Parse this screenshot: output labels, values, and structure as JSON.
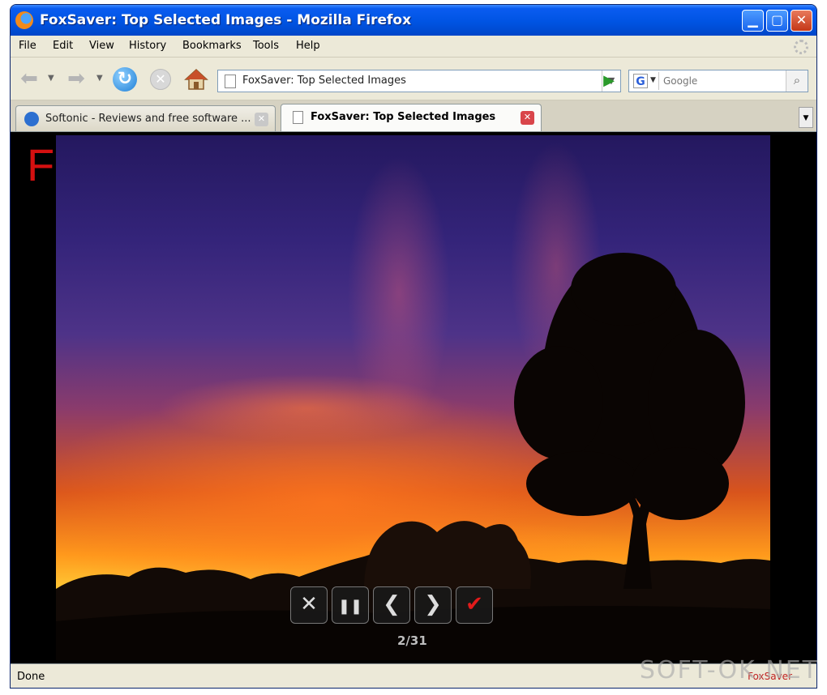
{
  "window": {
    "title": "FoxSaver: Top Selected Images - Mozilla Firefox",
    "app_icon": "firefox-icon",
    "controls": {
      "minimize": "minimize-icon",
      "maximize": "maximize-icon",
      "close": "close-icon"
    }
  },
  "menubar": {
    "items": [
      {
        "label": "File"
      },
      {
        "label": "Edit"
      },
      {
        "label": "View"
      },
      {
        "label": "History"
      },
      {
        "label": "Bookmarks"
      },
      {
        "label": "Tools"
      },
      {
        "label": "Help"
      }
    ]
  },
  "navbar": {
    "icons": [
      "back-arrow-icon",
      "forward-arrow-icon",
      "reload-icon",
      "stop-icon",
      "home-icon",
      "go-arrow-icon"
    ],
    "url": "FoxSaver: Top Selected Images",
    "search": {
      "engine_icon": "google-icon",
      "placeholder": "Google"
    }
  },
  "tabs": [
    {
      "label": "Softonic - Reviews and free software ...",
      "active": false,
      "icon": "softonic-icon"
    },
    {
      "label": "FoxSaver: Top Selected Images",
      "active": true,
      "icon": "page-icon"
    }
  ],
  "viewer": {
    "background_logo": "Fo",
    "controls": [
      {
        "name": "close",
        "icon": "x-icon",
        "glyph": "✕"
      },
      {
        "name": "pause",
        "icon": "pause-icon",
        "glyph": "❚❚"
      },
      {
        "name": "previous",
        "icon": "chevron-left-icon",
        "glyph": "❮"
      },
      {
        "name": "next",
        "icon": "chevron-right-icon",
        "glyph": "❯"
      },
      {
        "name": "select",
        "icon": "check-icon",
        "glyph": "✔"
      }
    ],
    "counter": "2/31"
  },
  "statusbar": {
    "text": "Done",
    "brand": "FoxSaver"
  },
  "watermark": "SOFT-OK.NET",
  "colors": {
    "titlebar": "#0054e3",
    "chrome": "#ece9d8",
    "close_button": "#c43717",
    "active_tab_close": "#d9454a",
    "check_mark": "#e21b1b"
  }
}
